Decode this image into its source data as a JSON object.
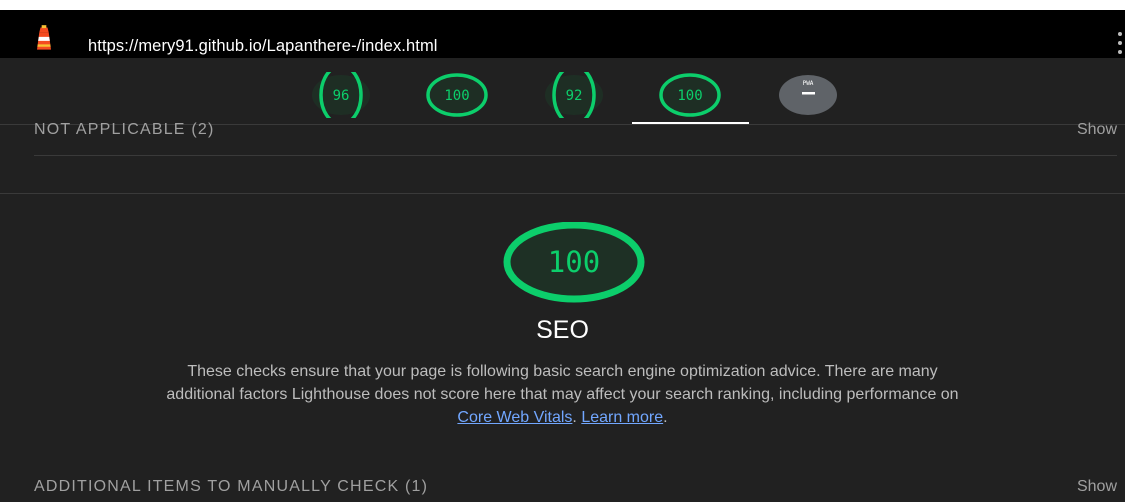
{
  "browser": {
    "url": "https://mery91.github.io/Lapanthere-/index.html",
    "logo_icon": "lighthouse-icon",
    "menu_icon": "more-vert-icon"
  },
  "gauges": [
    {
      "label": "96",
      "score": 96,
      "color": "#0cce6b"
    },
    {
      "label": "100",
      "score": 100,
      "color": "#0cce6b"
    },
    {
      "label": "92",
      "score": 92,
      "color": "#0cce6b"
    },
    {
      "label": "100",
      "score": 100,
      "color": "#0cce6b",
      "active": true
    }
  ],
  "pwa_badge": {
    "label": "PWA"
  },
  "not_applicable": {
    "label": "NOT APPLICABLE (2)",
    "show": "Show"
  },
  "category": {
    "score_label": "100",
    "score": 100,
    "title": "SEO",
    "desc_text": "These checks ensure that your page is following basic search engine optimization advice. There are many additional factors Lighthouse does not score here that may affect your search ranking, including performance on ",
    "link_cwv": "Core Web Vitals",
    "sep": ". ",
    "link_learn": "Learn more",
    "end": "."
  },
  "manual_check": {
    "label": "ADDITIONAL ITEMS TO MANUALLY CHECK (1)",
    "show": "Show"
  },
  "colors": {
    "pass_green": "#0cce6b",
    "background": "#212121",
    "link": "#72a7ff"
  }
}
